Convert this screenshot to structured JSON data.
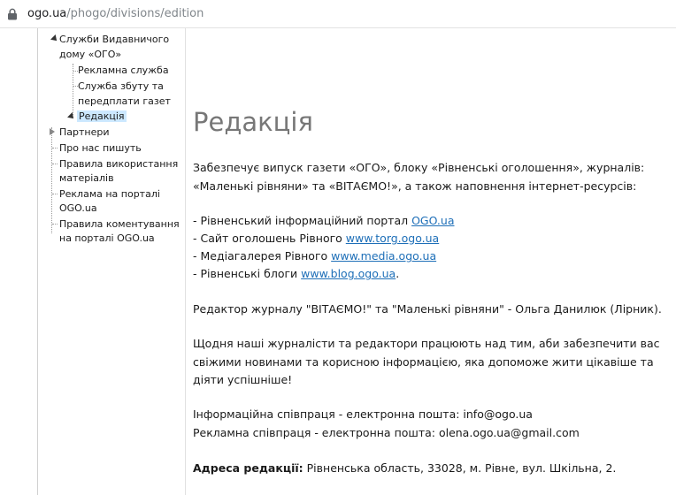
{
  "urlbar": {
    "host": "ogo.ua",
    "path": "/phogo/divisions/edition"
  },
  "sidebar": {
    "items": [
      {
        "label_1": "Служби Видавничого",
        "label_2": "дому «ОГО»"
      },
      {
        "label": "Рекламна служба"
      },
      {
        "label_1": "Служба збуту та",
        "label_2": "передплати газет"
      },
      {
        "label": "Редакція"
      },
      {
        "label": "Партнери"
      },
      {
        "label": "Про нас пишуть"
      },
      {
        "label_1": "Правила використання",
        "label_2": "матеріалів"
      },
      {
        "label_1": "Реклама на порталі",
        "label_2": "OGO.ua"
      },
      {
        "label_1": "Правила коментування",
        "label_2": "на порталі OGO.ua"
      }
    ]
  },
  "content": {
    "title": "Редакція",
    "intro_1": "Забезпечує випуск газети «ОГО», блоку «Рівненські оголошення», журналів:",
    "intro_2": "«Маленькі рівняни» та «ВІТАЄМО!», а також наповнення інтернет-ресурсів:",
    "resources": [
      {
        "prefix": "- Рівненський інформаційний портал ",
        "link": "OGO.ua",
        "suffix": ""
      },
      {
        "prefix": "- Сайт оголошень Рівного ",
        "link": "www.torg.ogo.ua",
        "suffix": ""
      },
      {
        "prefix": "- Медіагалерея Рівного ",
        "link": "www.media.ogo.ua",
        "suffix": ""
      },
      {
        "prefix": "- Рівненські блоги ",
        "link": "www.blog.ogo.ua",
        "suffix": "."
      }
    ],
    "editor": "Редактор журналу \"ВІТАЄМО!\" та \"Маленькі рівняни\" - Ольга Данилюк (Лірник).",
    "daily_1": "Щодня наші журналісти та редактори працюють над тим, аби забезпечити вас",
    "daily_2": "свіжими новинами та корисною інформацією, яка допоможе жити цікавіше та",
    "daily_3": "діяти успішніше!",
    "contact_info": "Інформаційна співпраця - електронна пошта: info@ogo.ua",
    "contact_ads": "Рекламна співпраця - електронна пошта: olena.ogo.ua@gmail.com",
    "address_label": "Адреса редакції:",
    "address_value": " Рівненська область, 33028, м. Рівне, вул. Шкільна, 2."
  }
}
